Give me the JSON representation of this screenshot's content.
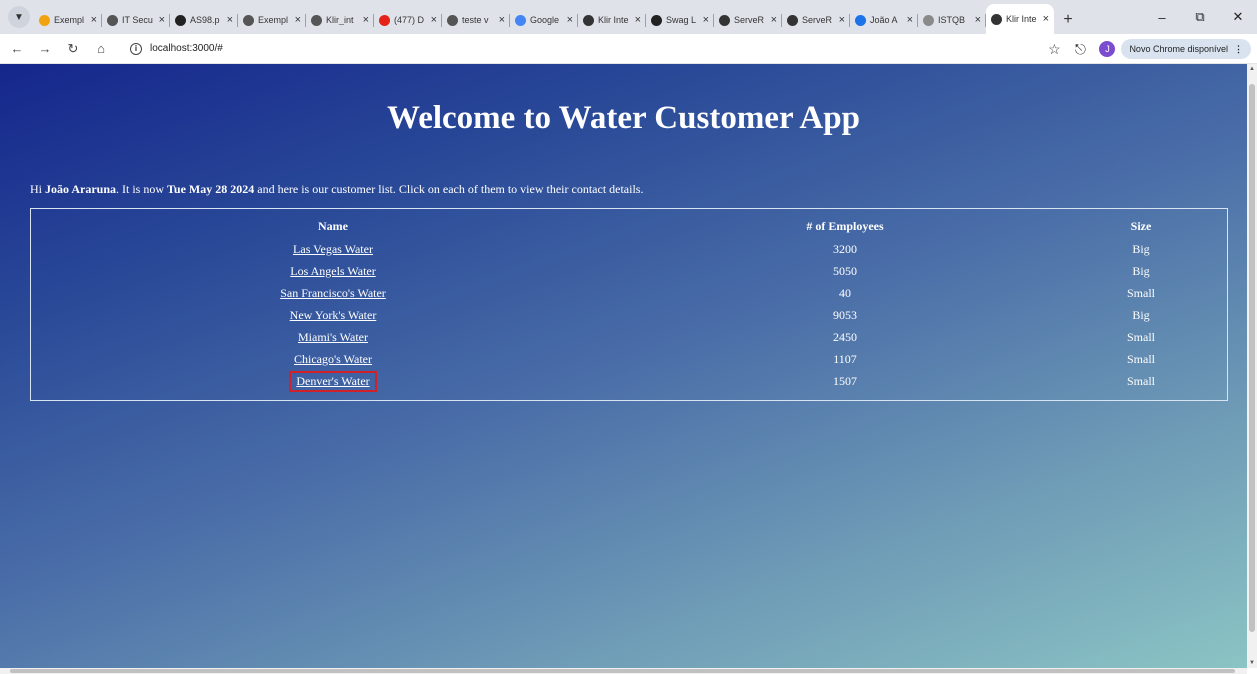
{
  "browser": {
    "tabs": [
      {
        "title": "Exempl",
        "fav_color": "#f2a20c"
      },
      {
        "title": "IT Secu",
        "fav_color": "#555555"
      },
      {
        "title": "AS98.p",
        "fav_color": "#222222"
      },
      {
        "title": "Exempl",
        "fav_color": "#555555"
      },
      {
        "title": "Klir_int",
        "fav_color": "#555555"
      },
      {
        "title": "(477) D",
        "fav_color": "#e62117"
      },
      {
        "title": "teste v",
        "fav_color": "#555555"
      },
      {
        "title": "Google",
        "fav_color": "#4285f4"
      },
      {
        "title": "Klir Inte",
        "fav_color": "#333333"
      },
      {
        "title": "Swag L",
        "fav_color": "#222222"
      },
      {
        "title": "ServeR",
        "fav_color": "#333333"
      },
      {
        "title": "ServeR",
        "fav_color": "#333333"
      },
      {
        "title": "João A",
        "fav_color": "#1a73e8"
      },
      {
        "title": "ISTQB",
        "fav_color": "#8a8a8a"
      },
      {
        "title": "Klir Inte",
        "fav_color": "#333333",
        "active": true
      }
    ],
    "url": "localhost:3000/#",
    "update_label": "Novo Chrome disponível",
    "profile_initial": "J"
  },
  "page": {
    "title": "Welcome to Water Customer App",
    "intro_hi": "Hi ",
    "user_name": "João Araruna",
    "intro_mid": ". It is now ",
    "date": "Tue May 28 2024",
    "intro_end": " and here is our customer list. Click on each of them to view their contact details."
  },
  "table": {
    "headers": [
      "Name",
      "# of Employees",
      "Size"
    ],
    "rows": [
      {
        "name": "Las Vegas Water",
        "employees": "3200",
        "size": "Big"
      },
      {
        "name": "Los Angels Water",
        "employees": "5050",
        "size": "Big"
      },
      {
        "name": "San Francisco's Water",
        "employees": "40",
        "size": "Small"
      },
      {
        "name": "New York's Water",
        "employees": "9053",
        "size": "Big"
      },
      {
        "name": "Miami's Water",
        "employees": "2450",
        "size": "Small"
      },
      {
        "name": "Chicago's Water",
        "employees": "1107",
        "size": "Small"
      },
      {
        "name": "Denver's Water",
        "employees": "1507",
        "size": "Small",
        "highlighted": true
      }
    ]
  },
  "colors": {
    "highlight": "#d0212b"
  }
}
